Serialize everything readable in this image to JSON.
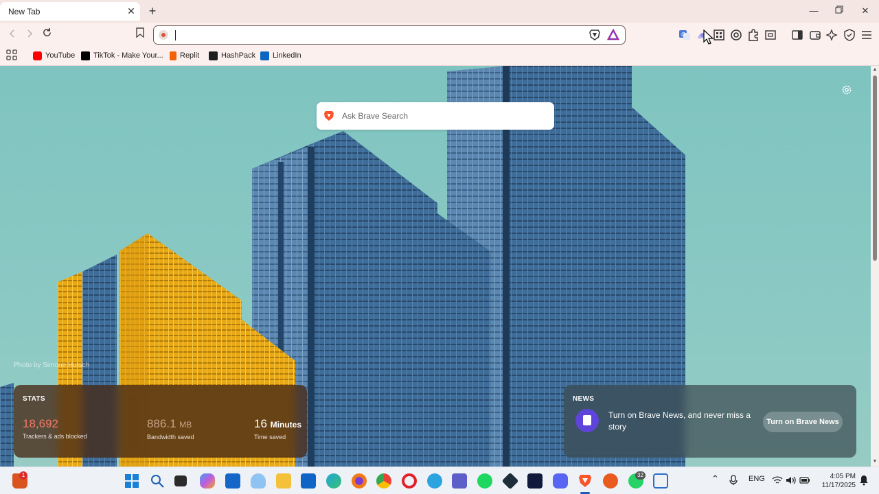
{
  "tab": {
    "title": "New Tab"
  },
  "omnibox": {
    "value": "",
    "placeholder": ""
  },
  "bookmarks": [
    {
      "label": "YouTube",
      "icon": "youtube-icon",
      "color": "#ff0000"
    },
    {
      "label": "TikTok - Make Your...",
      "icon": "tiktok-icon",
      "color": "#000000"
    },
    {
      "label": "Replit",
      "icon": "replit-icon",
      "color": "#f26207"
    },
    {
      "label": "HashPack",
      "icon": "hashpack-icon",
      "color": "#1f1f1f"
    },
    {
      "label": "LinkedIn",
      "icon": "linkedin-icon",
      "color": "#0a66c2"
    }
  ],
  "search": {
    "placeholder": "Ask Brave Search"
  },
  "photo_credit": "Photo by Simone Hutsch",
  "stats": {
    "label": "STATS",
    "trackers_value": "18,692",
    "trackers_label": "Trackers & ads blocked",
    "bandwidth_value": "886.1",
    "bandwidth_unit": "MB",
    "bandwidth_label": "Bandwidth saved",
    "time_value": "16",
    "time_unit": "Minutes",
    "time_label": "Time saved"
  },
  "news": {
    "label": "NEWS",
    "text": "Turn on Brave News, and never miss a story",
    "button": "Turn on Brave News"
  },
  "taskbar": {
    "badge_left": "1",
    "badge_whatsapp": "32",
    "lang": "ENG",
    "time": "4:05 PM",
    "date": "11/17/2025"
  },
  "colors": {
    "accent": "#fb542b",
    "stats_trackers": "#f37a65",
    "stats_bandwidth": "#c9a28a",
    "news_icon": "#5f44d9"
  }
}
